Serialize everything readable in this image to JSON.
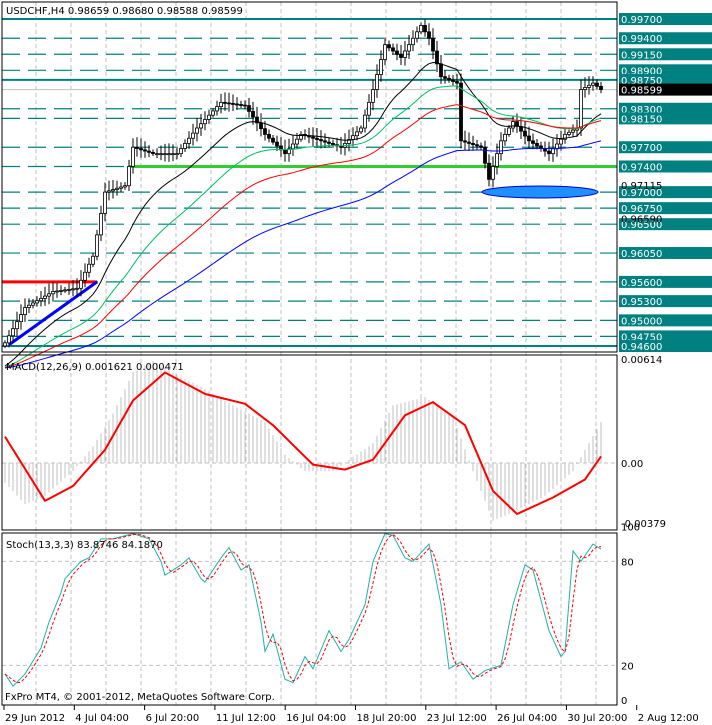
{
  "header": {
    "symbol_line": "USDCHF,H4  0.98659 0.98680 0.98588 0.98599"
  },
  "footer": {
    "copyright": "FxPro MT4, © 2001-2012, MetaQuotes Software Corp."
  },
  "colors": {
    "level": "#008080",
    "bull": "#000000",
    "green_line": "#33cc33",
    "red_line": "#ff0000",
    "trend": "#0000ff",
    "ellipse": "#1e90ff",
    "macd_hist": "#c0c0c0",
    "macd_signal": "#ff0000",
    "stoch_main": "#20b2aa",
    "stoch_signal": "#ff0000"
  },
  "chart_data": {
    "type": "line",
    "title": "USDCHF,H4",
    "ylim": [
      0.9455,
      0.9985
    ],
    "current_price": "0.98599",
    "price_levels": [
      "0.99700",
      "0.99400",
      "0.99150",
      "0.98900",
      "0.98750",
      "0.98300",
      "0.98150",
      "0.97700",
      "0.97400",
      "0.97000",
      "0.96750",
      "0.96500",
      "0.96050",
      "0.95600",
      "0.95300",
      "0.95000",
      "0.94750",
      "0.94600"
    ],
    "minor_labels": [
      "0.97115",
      "0.96590"
    ],
    "solid_levels": [
      0.997,
      0.9875,
      0.946
    ],
    "support_line": {
      "price": 0.974,
      "from_bar": 31,
      "to_bar": 153
    },
    "resistance_line": {
      "price": 0.956,
      "from_bar": 0,
      "to_bar": 23
    },
    "trendline": {
      "from": [
        1,
        0.9462
      ],
      "to": [
        23,
        0.956
      ]
    },
    "x_tick_labels": [
      "29 Jun 2012",
      "4 Jul 04:00",
      "6 Jul 20:00",
      "11 Jul 12:00",
      "16 Jul 04:00",
      "18 Jul 20:00",
      "23 Jul 12:00",
      "26 Jul 04:00",
      "30 Jul 20:00",
      "2 Aug 12:00"
    ],
    "close_points": [
      [
        0,
        0.9465
      ],
      [
        5,
        0.952
      ],
      [
        12,
        0.9545
      ],
      [
        18,
        0.955
      ],
      [
        22,
        0.96
      ],
      [
        25,
        0.97
      ],
      [
        30,
        0.971
      ],
      [
        32,
        0.977
      ],
      [
        37,
        0.976
      ],
      [
        43,
        0.976
      ],
      [
        48,
        0.98
      ],
      [
        54,
        0.984
      ],
      [
        60,
        0.9835
      ],
      [
        65,
        0.979
      ],
      [
        70,
        0.976
      ],
      [
        74,
        0.979
      ],
      [
        79,
        0.978
      ],
      [
        84,
        0.977
      ],
      [
        89,
        0.98
      ],
      [
        92,
        0.986
      ],
      [
        95,
        0.993
      ],
      [
        99,
        0.991
      ],
      [
        104,
        0.996
      ],
      [
        106,
        0.994
      ],
      [
        109,
        0.988
      ],
      [
        113,
        0.987
      ],
      [
        114,
        0.978
      ],
      [
        119,
        0.977
      ],
      [
        121,
        0.972
      ],
      [
        124,
        0.978
      ],
      [
        127,
        0.981
      ],
      [
        131,
        0.978
      ],
      [
        136,
        0.976
      ],
      [
        140,
        0.979
      ],
      [
        143,
        0.98
      ],
      [
        144,
        0.986
      ],
      [
        147,
        0.987
      ],
      [
        149,
        0.98599
      ]
    ],
    "macd": {
      "label": "MACD(12,26,9) 0.001621 0.000471",
      "ylim": [
        -0.00379,
        0.00614
      ],
      "tick_labels": [
        "0.00614",
        "0.00",
        "-0.00379"
      ],
      "histogram": [
        [
          0,
          -0.0012
        ],
        [
          5,
          -0.0025
        ],
        [
          10,
          -0.002
        ],
        [
          17,
          -0.0005
        ],
        [
          22,
          0.001
        ],
        [
          27,
          0.003
        ],
        [
          32,
          0.0055
        ],
        [
          37,
          0.0062
        ],
        [
          42,
          0.0055
        ],
        [
          50,
          0.0045
        ],
        [
          57,
          0.0035
        ],
        [
          65,
          0.0025
        ],
        [
          70,
          0.0005
        ],
        [
          75,
          -0.0005
        ],
        [
          82,
          -0.0005
        ],
        [
          92,
          0.0012
        ],
        [
          97,
          0.0035
        ],
        [
          105,
          0.004
        ],
        [
          112,
          0.0028
        ],
        [
          117,
          -0.0005
        ],
        [
          122,
          -0.0035
        ],
        [
          127,
          -0.003
        ],
        [
          135,
          -0.002
        ],
        [
          142,
          -0.0005
        ],
        [
          149,
          0.0025
        ]
      ],
      "signal": [
        [
          0,
          0.0016
        ],
        [
          10,
          -0.0023
        ],
        [
          17,
          -0.0014
        ],
        [
          25,
          0.0008
        ],
        [
          32,
          0.0038
        ],
        [
          40,
          0.0055
        ],
        [
          50,
          0.0042
        ],
        [
          60,
          0.0036
        ],
        [
          67,
          0.0023
        ],
        [
          77,
          -0.0001
        ],
        [
          85,
          -0.0004
        ],
        [
          92,
          0.0002
        ],
        [
          100,
          0.0029
        ],
        [
          107,
          0.0037
        ],
        [
          115,
          0.0023
        ],
        [
          122,
          -0.0017
        ],
        [
          128,
          -0.0031
        ],
        [
          137,
          -0.0021
        ],
        [
          145,
          -0.001
        ],
        [
          149,
          0.0004
        ]
      ]
    },
    "stoch": {
      "label": "Stoch(13,3,3) 83.8746 84.1870",
      "ylim": [
        0,
        100
      ],
      "tick_labels": [
        "100",
        "80",
        "20",
        "0"
      ],
      "signal_period": 3,
      "main": [
        [
          0,
          15
        ],
        [
          2,
          8
        ],
        [
          5,
          15
        ],
        [
          9,
          30
        ],
        [
          11,
          45
        ],
        [
          14,
          62
        ],
        [
          15,
          70
        ],
        [
          17,
          75
        ],
        [
          19,
          80
        ],
        [
          21,
          82
        ],
        [
          24,
          93
        ],
        [
          27,
          93
        ],
        [
          32,
          96
        ],
        [
          36,
          93
        ],
        [
          39,
          80
        ],
        [
          40,
          72
        ],
        [
          44,
          78
        ],
        [
          46,
          82
        ],
        [
          49,
          70
        ],
        [
          50,
          68
        ],
        [
          54,
          82
        ],
        [
          56,
          88
        ],
        [
          59,
          75
        ],
        [
          61,
          78
        ],
        [
          64,
          45
        ],
        [
          65,
          28
        ],
        [
          67,
          38
        ],
        [
          70,
          12
        ],
        [
          72,
          10
        ],
        [
          75,
          25
        ],
        [
          77,
          18
        ],
        [
          81,
          40
        ],
        [
          84,
          28
        ],
        [
          86,
          35
        ],
        [
          90,
          55
        ],
        [
          92,
          80
        ],
        [
          95,
          96
        ],
        [
          97,
          95
        ],
        [
          100,
          82
        ],
        [
          102,
          80
        ],
        [
          106,
          90
        ],
        [
          109,
          55
        ],
        [
          111,
          18
        ],
        [
          114,
          22
        ],
        [
          117,
          12
        ],
        [
          120,
          17
        ],
        [
          124,
          20
        ],
        [
          127,
          55
        ],
        [
          130,
          78
        ],
        [
          132,
          75
        ],
        [
          136,
          40
        ],
        [
          139,
          25
        ],
        [
          140,
          28
        ],
        [
          142,
          86
        ],
        [
          144,
          80
        ],
        [
          147,
          90
        ],
        [
          149,
          87
        ]
      ]
    }
  }
}
